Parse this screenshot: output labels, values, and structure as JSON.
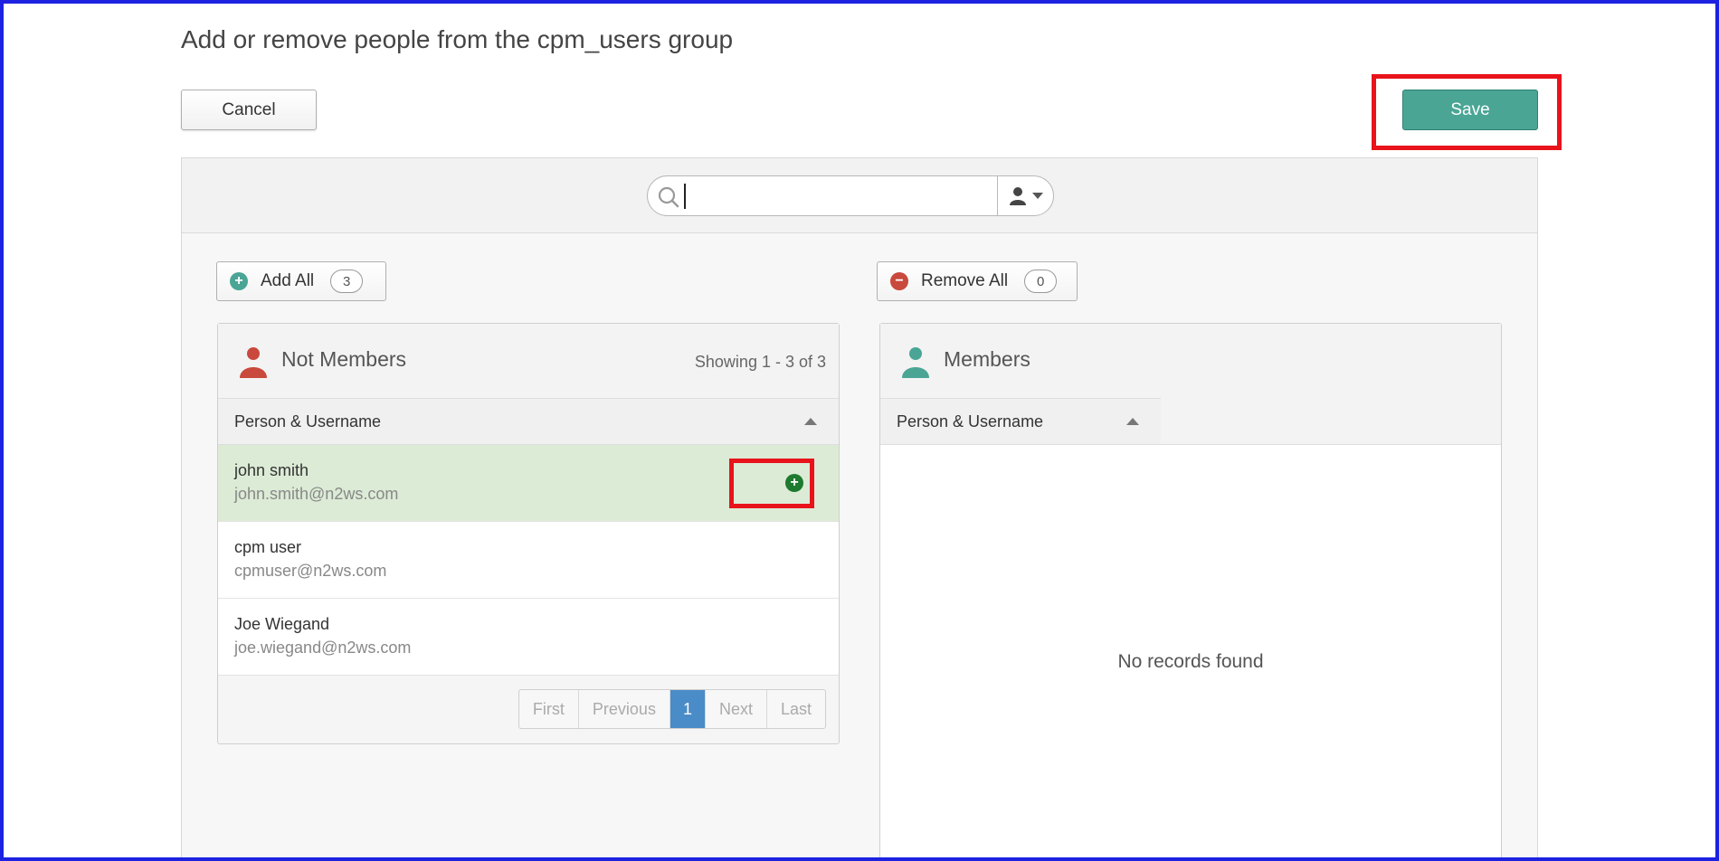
{
  "page": {
    "title": "Add or remove people from the cpm_users group",
    "cancel_label": "Cancel",
    "save_label": "Save"
  },
  "search": {
    "value": "",
    "placeholder": "",
    "icon": "search-icon",
    "filter_icon": "person-filter-icon"
  },
  "bulk": {
    "add_all_label": "Add All",
    "add_all_count": "3",
    "remove_all_label": "Remove All",
    "remove_all_count": "0"
  },
  "not_members": {
    "title": "Not Members",
    "showing": "Showing 1 - 3 of 3",
    "column": "Person & Username",
    "rows": [
      {
        "name": "john smith",
        "email": "john.smith@n2ws.com"
      },
      {
        "name": "cpm user",
        "email": "cpmuser@n2ws.com"
      },
      {
        "name": "Joe Wiegand",
        "email": "joe.wiegand@n2ws.com"
      }
    ],
    "pager": {
      "first": "First",
      "previous": "Previous",
      "current": "1",
      "next": "Next",
      "last": "Last"
    }
  },
  "members": {
    "title": "Members",
    "column": "Person & Username",
    "empty": "No records found"
  },
  "colors": {
    "save": "#4aa595",
    "not_members_icon": "#c9493c",
    "members_icon": "#4aa595",
    "add_icon": "#1e7a2e",
    "remove_icon": "#c9493c",
    "highlight": "#e8131b",
    "selected_row": "#dcebd6",
    "pager_active": "#4a8cc7"
  }
}
